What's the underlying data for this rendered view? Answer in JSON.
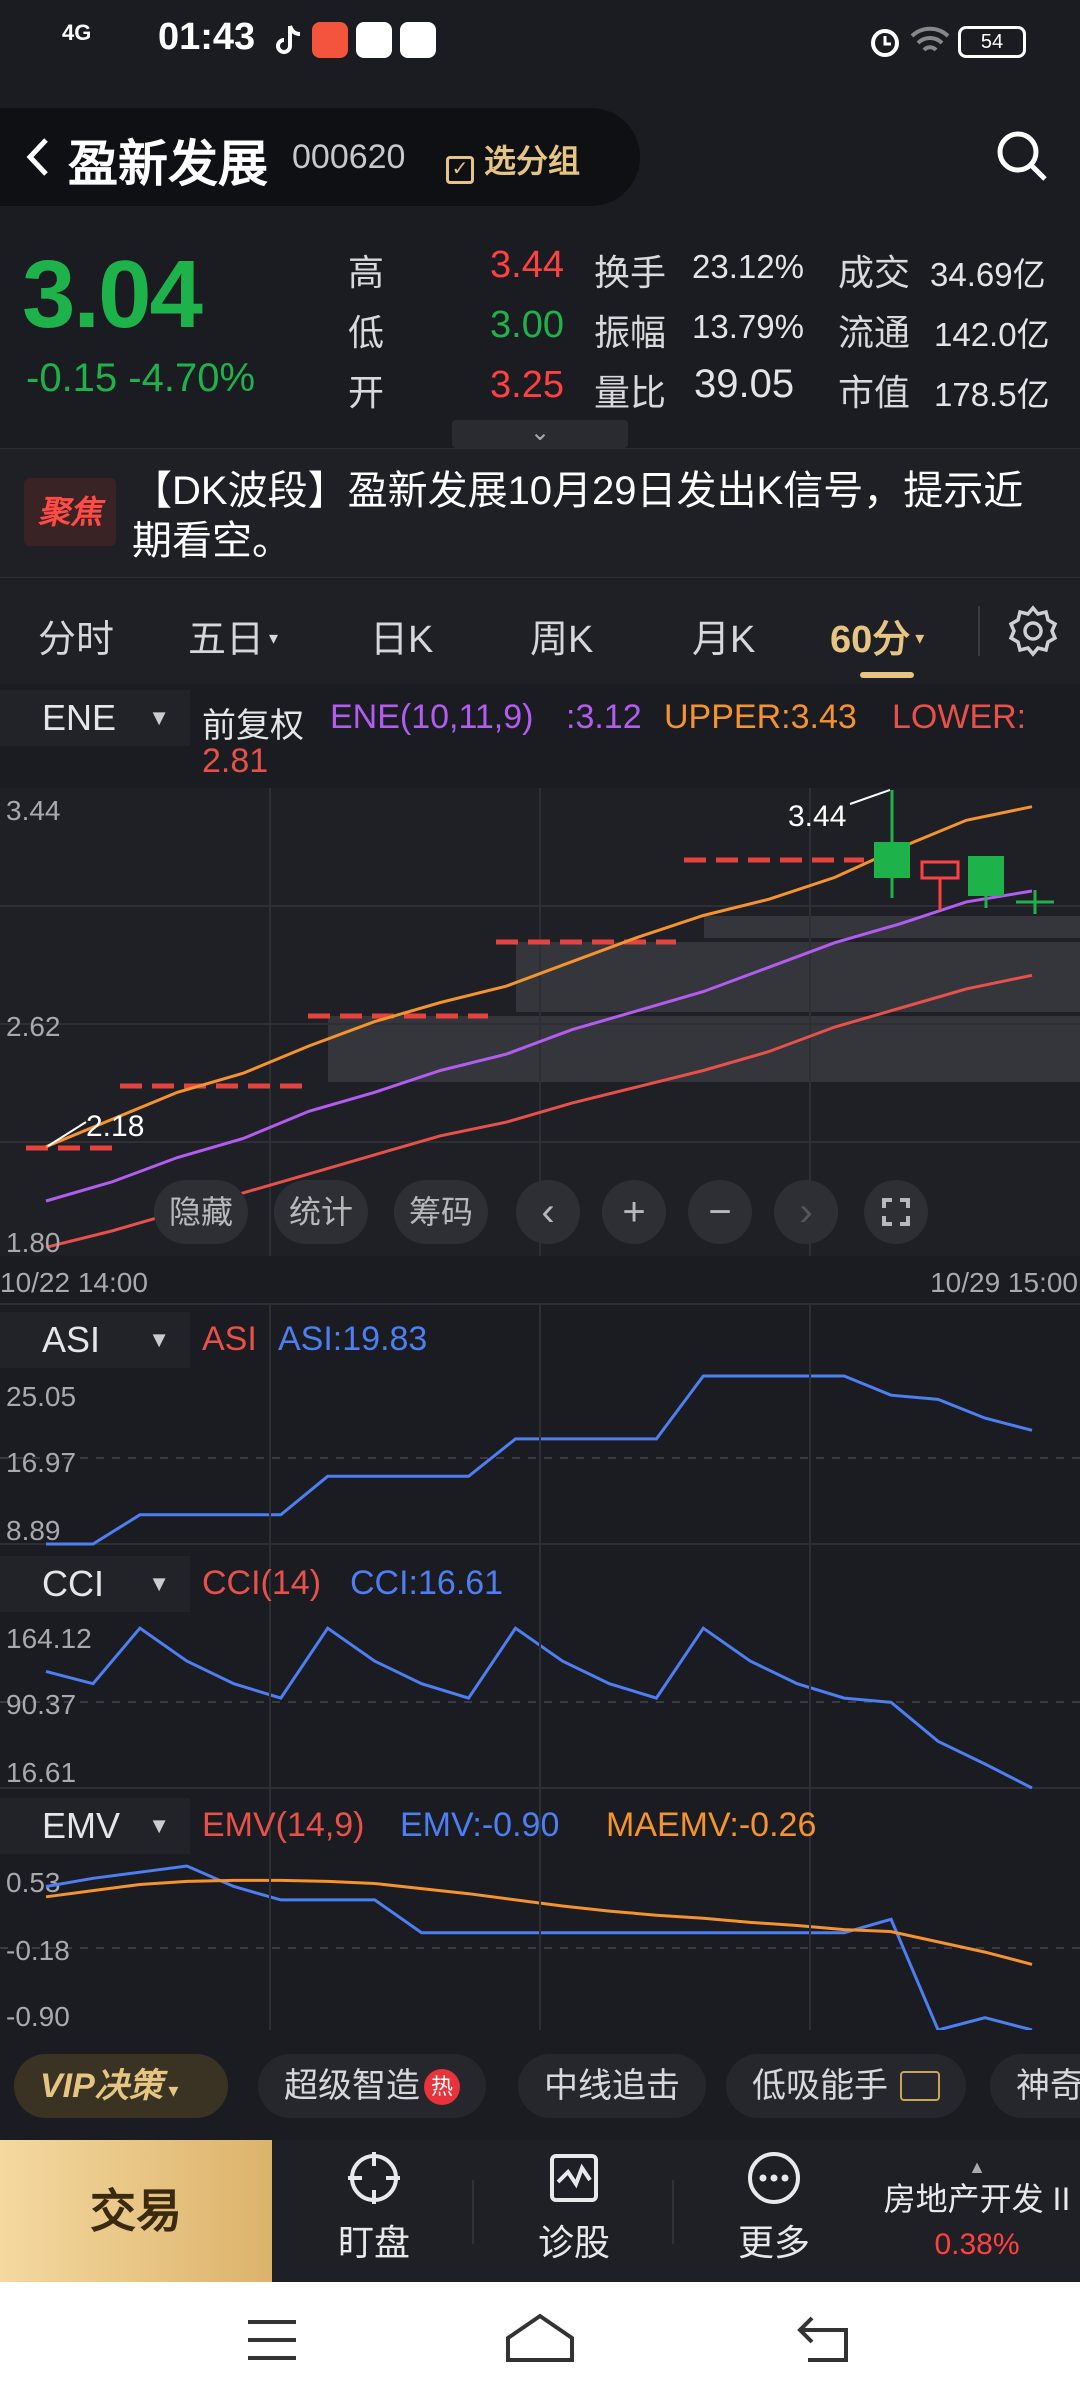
{
  "status_bar": {
    "network": "4G",
    "time": "01:43",
    "battery": "54"
  },
  "header": {
    "back_icon": "chevron-left-icon",
    "stock_name": "盈新发展",
    "stock_code": "000620",
    "group_label": "选分组",
    "search_icon": "search-icon"
  },
  "quote": {
    "price": "3.04",
    "change": "-0.15  -4.70%",
    "high_label": "高",
    "high": "3.44",
    "low_label": "低",
    "low": "3.00",
    "open_label": "开",
    "open": "3.25",
    "turnover_label": "换手",
    "turnover": "23.12%",
    "amplitude_label": "振幅",
    "amplitude": "13.79%",
    "volume_ratio_label": "量比",
    "volume_ratio": "39.05",
    "amount_label": "成交",
    "amount": "34.69亿",
    "float_label": "流通",
    "float": "142.0亿",
    "mcap_label": "市值",
    "mcap": "178.5亿",
    "colors": {
      "up": "#ff4040",
      "down": "#1db34a"
    }
  },
  "news": {
    "badge": "聚焦",
    "text": "【DK波段】盈新发展10月29日发出K信号，提示近期看空。"
  },
  "tabs": {
    "items": [
      "分时",
      "五日",
      "日K",
      "周K",
      "月K",
      "60分"
    ],
    "active": "60分",
    "settings_icon": "gear-icon"
  },
  "main_indicator": {
    "name": "ENE",
    "adjust": "前复权",
    "params": "ENE(10,11,9)",
    "ene": ":3.12",
    "upper": "UPPER:3.43",
    "lower_label": "LOWER:",
    "lower_value": "2.81",
    "y_ticks": [
      "3.44",
      "2.62",
      "1.80"
    ],
    "x_start": "10/22 14:00",
    "x_end": "10/29 15:00",
    "low_annot": "2.18",
    "high_annot": "3.44",
    "buttons": [
      "隐藏",
      "统计",
      "筹码"
    ],
    "colors": {
      "ene": "#b35cf0",
      "upper": "#f5932f",
      "lower": "#e8504a",
      "up": "#ff4040",
      "down": "#1db34a"
    }
  },
  "chart_data": [
    {
      "type": "line",
      "title": "ENE",
      "ylim": [
        1.8,
        3.44
      ],
      "series": [
        {
          "name": "UPPER",
          "values": [
            2.18,
            2.28,
            2.38,
            2.45,
            2.55,
            2.64,
            2.71,
            2.77,
            2.86,
            2.95,
            3.03,
            3.09,
            3.17,
            3.28,
            3.38,
            3.43
          ]
        },
        {
          "name": "ENE",
          "values": [
            1.98,
            2.05,
            2.14,
            2.21,
            2.31,
            2.38,
            2.46,
            2.52,
            2.61,
            2.68,
            2.75,
            2.84,
            2.93,
            3.0,
            3.08,
            3.12
          ]
        },
        {
          "name": "LOWER",
          "values": [
            1.81,
            1.87,
            1.94,
            2.01,
            2.08,
            2.15,
            2.22,
            2.27,
            2.34,
            2.4,
            2.46,
            2.53,
            2.62,
            2.69,
            2.76,
            2.81
          ]
        }
      ]
    },
    {
      "type": "line",
      "title": "ASI",
      "ylim": [
        8.89,
        25.05
      ],
      "series": [
        {
          "name": "ASI",
          "values": [
            8.89,
            8.89,
            11.7,
            11.7,
            11.7,
            11.7,
            15.4,
            15.4,
            15.4,
            15.4,
            19.0,
            19.0,
            19.0,
            19.0,
            25.05,
            25.05,
            25.05,
            25.05,
            23.2,
            22.8,
            21.0,
            19.83
          ]
        }
      ]
    },
    {
      "type": "line",
      "title": "CCI",
      "ylim": [
        16.61,
        164.12
      ],
      "series": [
        {
          "name": "CCI",
          "values": [
            130,
            118,
            172,
            140,
            118,
            104,
            172,
            140,
            118,
            104,
            172,
            140,
            118,
            104,
            172,
            140,
            118,
            104,
            100,
            62,
            40,
            16.61
          ]
        }
      ]
    },
    {
      "type": "line",
      "title": "EMV",
      "ylim": [
        -0.9,
        0.53
      ],
      "series": [
        {
          "name": "EMV",
          "values": [
            0.5,
            0.58,
            0.64,
            0.7,
            0.5,
            0.37,
            0.37,
            0.37,
            0.05,
            0.05,
            0.05,
            0.05,
            0.05,
            0.05,
            0.05,
            0.05,
            0.05,
            0.05,
            0.18,
            -0.9,
            -0.78,
            -0.9
          ]
        },
        {
          "name": "MAEMV",
          "values": [
            0.4,
            0.46,
            0.52,
            0.55,
            0.56,
            0.56,
            0.55,
            0.53,
            0.48,
            0.43,
            0.37,
            0.31,
            0.26,
            0.22,
            0.19,
            0.15,
            0.12,
            0.08,
            0.06,
            -0.04,
            -0.14,
            -0.26
          ]
        }
      ]
    }
  ],
  "asi": {
    "name": "ASI",
    "label": "ASI",
    "value": "ASI:19.83",
    "y_ticks": [
      "25.05",
      "16.97",
      "8.89"
    ],
    "color": "#4d7ef2"
  },
  "cci": {
    "name": "CCI",
    "label": "CCI(14)",
    "value": "CCI:16.61",
    "y_ticks": [
      "164.12",
      "90.37",
      "16.61"
    ],
    "color": "#4d7ef2"
  },
  "emv": {
    "name": "EMV",
    "label": "EMV(14,9)",
    "emv": "EMV:-0.90",
    "maemv": "MAEMV:-0.26",
    "y_ticks": [
      "0.53",
      "-0.18",
      "-0.90"
    ],
    "colors": {
      "emv": "#4d7ef2",
      "maemv": "#f5932f"
    }
  },
  "strategy": {
    "vip": "VIP决策",
    "hot": "热",
    "chips": [
      "超级智造",
      "中线追击",
      "低吸能手",
      "神奇"
    ]
  },
  "bottom_nav": {
    "trade": "交易",
    "items": [
      "盯盘",
      "诊股",
      "更多"
    ],
    "sector_name": "房地产开发 II",
    "sector_change": "0.38%"
  }
}
